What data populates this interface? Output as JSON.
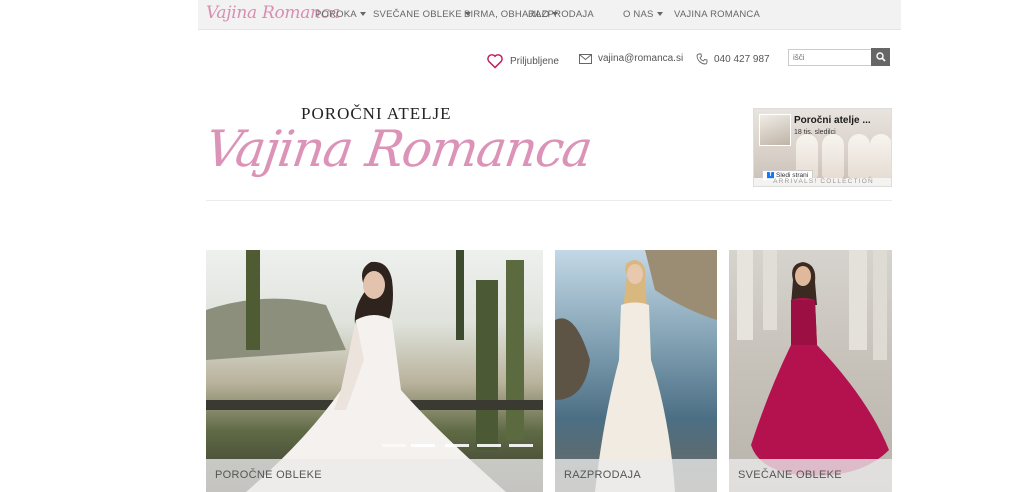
{
  "navbar": {
    "brand": "Vajina Romanca",
    "items": [
      {
        "label": "POROKA",
        "dropdown": true
      },
      {
        "label": "SVEČANE OBLEKE",
        "dropdown": true
      },
      {
        "label": "BIRMA, OBHAJILO",
        "dropdown": true
      },
      {
        "label": "RAZPRODAJA",
        "dropdown": false
      },
      {
        "label": "O NAS",
        "dropdown": true
      },
      {
        "label": "VAJINA ROMANCA",
        "dropdown": false
      }
    ]
  },
  "contact": {
    "favorites_label": "Priljubljene",
    "email": "vajina@romanca.si",
    "phone": "040 427 987"
  },
  "search": {
    "placeholder": "išči"
  },
  "header": {
    "atelje": "POROČNI ATELJE",
    "logo_script": "Vajina Romanca"
  },
  "facebook_widget": {
    "page_name": "Poročni atelje ...",
    "followers": "18 tis. sledilci",
    "follow_label": "Sledi strani",
    "banner_text": "ARRIVALS! COLLECTION"
  },
  "tiles": [
    {
      "label": "POROČNE OBLEKE",
      "slides": 5
    },
    {
      "label": "RAZPRODAJA"
    },
    {
      "label": "SVEČANE OBLEKE"
    }
  ],
  "colors": {
    "brand_pink": "#dc93b8",
    "navbar_bg": "#f2f2f2",
    "search_button": "#666666",
    "evening_dress": "#b3124e"
  }
}
